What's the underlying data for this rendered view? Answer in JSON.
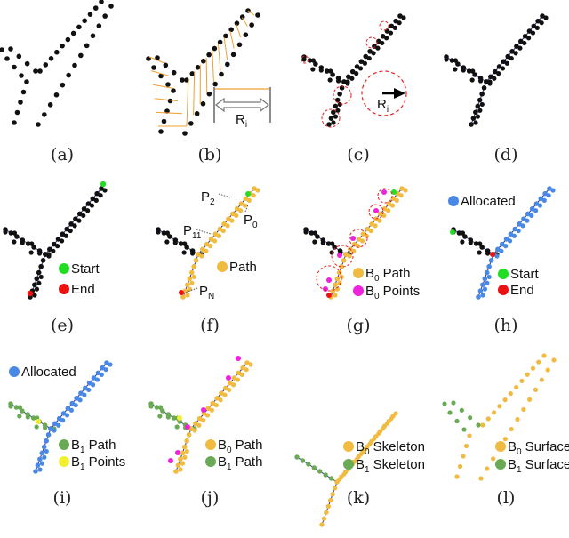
{
  "colors": {
    "point": "#111111",
    "arrow": "#f0a030",
    "circle": "#e82020",
    "start": "#22dd22",
    "end": "#ee1111",
    "path": "#f0bb40",
    "b0_points": "#ee22dd",
    "allocated": "#4a88e6",
    "b1_path": "#6aaa55",
    "b1_points": "#f0f030",
    "edge": "#2a2a88",
    "ri_bar": "#888888"
  },
  "panels": [
    {
      "id": "a",
      "caption": "(a)"
    },
    {
      "id": "b",
      "caption": "(b)",
      "annotation": {
        "label": "R",
        "sub": "i"
      }
    },
    {
      "id": "c",
      "caption": "(c)",
      "annotation": {
        "label": "R",
        "sub": "i"
      }
    },
    {
      "id": "d",
      "caption": "(d)"
    },
    {
      "id": "e",
      "caption": "(e)",
      "legend": [
        {
          "text": "Start",
          "sub": "",
          "color": "start"
        },
        {
          "text": "End",
          "sub": "",
          "color": "end"
        }
      ]
    },
    {
      "id": "f",
      "caption": "(f)",
      "legend": [
        {
          "text": "Path",
          "sub": "",
          "color": "path"
        }
      ],
      "point_labels": [
        {
          "p": "P",
          "sub": "2"
        },
        {
          "p": "P",
          "sub": "0"
        },
        {
          "p": "P",
          "sub": "11"
        },
        {
          "p": "P",
          "sub": "N"
        }
      ]
    },
    {
      "id": "g",
      "caption": "(g)",
      "legend": [
        {
          "prefix": "B",
          "psub": "0",
          "text": "Path",
          "color": "path"
        },
        {
          "prefix": "B",
          "psub": "0",
          "text": "Points",
          "color": "b0_points"
        }
      ]
    },
    {
      "id": "h",
      "caption": "(h)",
      "legend": [
        {
          "text": "Allocated",
          "color": "allocated"
        },
        {
          "text": "Start",
          "color": "start"
        },
        {
          "text": "End",
          "color": "end"
        }
      ]
    },
    {
      "id": "i",
      "caption": "(i)",
      "legend": [
        {
          "text": "Allocated",
          "color": "allocated"
        },
        {
          "prefix": "B",
          "psub": "1",
          "text": "Path",
          "color": "b1_path"
        },
        {
          "prefix": "B",
          "psub": "1",
          "text": "Points",
          "color": "b1_points"
        }
      ]
    },
    {
      "id": "j",
      "caption": "(j)",
      "legend": [
        {
          "prefix": "B",
          "psub": "0",
          "text": "Path",
          "color": "path"
        },
        {
          "prefix": "B",
          "psub": "1",
          "text": "Path",
          "color": "b1_path"
        }
      ]
    },
    {
      "id": "k",
      "caption": "(k)",
      "legend": [
        {
          "prefix": "B",
          "psub": "0",
          "text": "Skeleton",
          "color": "path"
        },
        {
          "prefix": "B",
          "psub": "1",
          "text": "Skeleton",
          "color": "b1_path"
        }
      ]
    },
    {
      "id": "l",
      "caption": "(l)",
      "legend": [
        {
          "prefix": "B",
          "psub": "0",
          "text": "Surface",
          "color": "path"
        },
        {
          "prefix": "B",
          "psub": "1",
          "text": "Surface",
          "color": "b1_path"
        }
      ]
    }
  ]
}
